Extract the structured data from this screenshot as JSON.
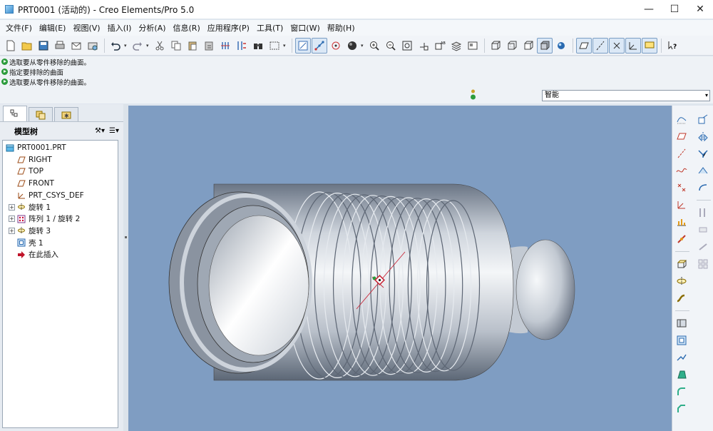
{
  "window": {
    "title": "PRT0001 (活动的) - Creo Elements/Pro 5.0",
    "controls": [
      "minimize-icon",
      "maximize-icon",
      "close-icon"
    ]
  },
  "menubar": {
    "items": [
      "文件(F)",
      "编辑(E)",
      "视图(V)",
      "插入(I)",
      "分析(A)",
      "信息(R)",
      "应用程序(P)",
      "工具(T)",
      "窗口(W)",
      "帮助(H)"
    ]
  },
  "messages": [
    "选取要从零件移除的曲面。",
    "指定要排除的曲面",
    "选取要从零件移除的曲面。"
  ],
  "filter": {
    "value": "智能"
  },
  "panel": {
    "tree_title": "模型树"
  },
  "model_tree": {
    "items": [
      {
        "label": "PRT0001.PRT",
        "icon": "part-icon"
      },
      {
        "label": "RIGHT",
        "icon": "datum-plane-icon"
      },
      {
        "label": "TOP",
        "icon": "datum-plane-icon"
      },
      {
        "label": "FRONT",
        "icon": "datum-plane-icon"
      },
      {
        "label": "PRT_CSYS_DEF",
        "icon": "csys-icon"
      },
      {
        "label": "旋转 1",
        "icon": "revolve-icon",
        "expandable": true
      },
      {
        "label": "阵列 1 / 旋转 2",
        "icon": "pattern-icon",
        "expandable": true
      },
      {
        "label": "旋转 3",
        "icon": "revolve-icon",
        "expandable": true
      },
      {
        "label": "壳 1",
        "icon": "shell-icon"
      },
      {
        "label": "在此插入",
        "icon": "insert-here-icon"
      }
    ]
  },
  "colors": {
    "viewport_bg": "#7f9dc2",
    "model_light": "#eef1f5",
    "model_dark": "#5f6a79",
    "message_green": "#2c9c3c"
  }
}
